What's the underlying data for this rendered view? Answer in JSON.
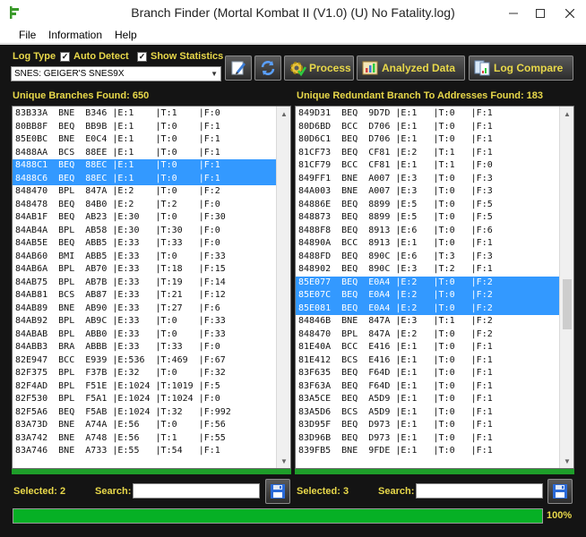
{
  "window": {
    "title": "Branch Finder (Mortal Kombat II (V1.0) (U) No Fatality.log)"
  },
  "menu": [
    "File",
    "Information",
    "Help"
  ],
  "options": {
    "log_type_label": "Log Type",
    "auto_detect_label": "Auto Detect",
    "auto_detect_checked": true,
    "show_statistics_label": "Show Statistics",
    "show_statistics_checked": true,
    "log_type_value": "SNES: GEIGER'S SNES9X"
  },
  "toolbar": {
    "edit_icon": "edit-icon",
    "refresh_icon": "refresh-icon",
    "process_label": "Process",
    "analyzed_label": "Analyzed Data",
    "compare_label": "Log Compare"
  },
  "left_panel": {
    "title": "Unique Branches Found: 650",
    "rows": [
      {
        "text": "83B33A  BNE  B346 |E:1    |T:1    |F:0",
        "selected": false
      },
      {
        "text": "80BB8F  BEQ  BB9B |E:1    |T:0    |F:1",
        "selected": false
      },
      {
        "text": "85E0BC  BNE  E0C4 |E:1    |T:0    |F:1",
        "selected": false
      },
      {
        "text": "8488AA  BCS  88EE |E:1    |T:0    |F:1",
        "selected": false
      },
      {
        "text": "8488C1  BEQ  88EC |E:1    |T:0    |F:1",
        "selected": true
      },
      {
        "text": "8488C6  BEQ  88EC |E:1    |T:0    |F:1",
        "selected": true
      },
      {
        "text": "848470  BPL  847A |E:2    |T:0    |F:2",
        "selected": false
      },
      {
        "text": "848478  BEQ  84B0 |E:2    |T:2    |F:0",
        "selected": false
      },
      {
        "text": "84AB1F  BEQ  AB23 |E:30   |T:0    |F:30",
        "selected": false
      },
      {
        "text": "84AB4A  BPL  AB58 |E:30   |T:30   |F:0",
        "selected": false
      },
      {
        "text": "84AB5E  BEQ  ABB5 |E:33   |T:33   |F:0",
        "selected": false
      },
      {
        "text": "84AB60  BMI  ABB5 |E:33   |T:0    |F:33",
        "selected": false
      },
      {
        "text": "84AB6A  BPL  AB70 |E:33   |T:18   |F:15",
        "selected": false
      },
      {
        "text": "84AB75  BPL  AB7B |E:33   |T:19   |F:14",
        "selected": false
      },
      {
        "text": "84AB81  BCS  AB87 |E:33   |T:21   |F:12",
        "selected": false
      },
      {
        "text": "84AB89  BNE  AB90 |E:33   |T:27   |F:6",
        "selected": false
      },
      {
        "text": "84AB92  BPL  AB9C |E:33   |T:0    |F:33",
        "selected": false
      },
      {
        "text": "84ABAB  BPL  ABB0 |E:33   |T:0    |F:33",
        "selected": false
      },
      {
        "text": "84ABB3  BRA  ABBB |E:33   |T:33   |F:0",
        "selected": false
      },
      {
        "text": "82E947  BCC  E939 |E:536  |T:469  |F:67",
        "selected": false
      },
      {
        "text": "82F375  BPL  F37B |E:32   |T:0    |F:32",
        "selected": false
      },
      {
        "text": "82F4AD  BPL  F51E |E:1024 |T:1019 |F:5",
        "selected": false
      },
      {
        "text": "82F530  BPL  F5A1 |E:1024 |T:1024 |F:0",
        "selected": false
      },
      {
        "text": "82F5A6  BEQ  F5AB |E:1024 |T:32   |F:992",
        "selected": false
      },
      {
        "text": "83A73D  BNE  A74A |E:56   |T:0    |F:56",
        "selected": false
      },
      {
        "text": "83A742  BNE  A748 |E:56   |T:1    |F:55",
        "selected": false
      },
      {
        "text": "83A746  BNE  A733 |E:55   |T:54   |F:1",
        "selected": false
      }
    ],
    "selected_label": "Selected: 2",
    "search_label": "Search:",
    "search_value": ""
  },
  "right_panel": {
    "title": "Unique Redundant Branch To Addresses Found: 183",
    "rows": [
      {
        "text": "849D31  BEQ  9D7D |E:1   |T:0   |F:1",
        "selected": false
      },
      {
        "text": "80D6BD  BCC  D706 |E:1   |T:0   |F:1",
        "selected": false
      },
      {
        "text": "80D6C1  BEQ  D706 |E:1   |T:0   |F:1",
        "selected": false
      },
      {
        "text": "81CF73  BEQ  CF81 |E:2   |T:1   |F:1",
        "selected": false
      },
      {
        "text": "81CF79  BCC  CF81 |E:1   |T:1   |F:0",
        "selected": false
      },
      {
        "text": "849FF1  BNE  A007 |E:3   |T:0   |F:3",
        "selected": false
      },
      {
        "text": "84A003  BNE  A007 |E:3   |T:0   |F:3",
        "selected": false
      },
      {
        "text": "84886E  BEQ  8899 |E:5   |T:0   |F:5",
        "selected": false
      },
      {
        "text": "848873  BEQ  8899 |E:5   |T:0   |F:5",
        "selected": false
      },
      {
        "text": "8488F8  BEQ  8913 |E:6   |T:0   |F:6",
        "selected": false
      },
      {
        "text": "84890A  BCC  8913 |E:1   |T:0   |F:1",
        "selected": false
      },
      {
        "text": "8488FD  BEQ  890C |E:6   |T:3   |F:3",
        "selected": false
      },
      {
        "text": "848902  BEQ  890C |E:3   |T:2   |F:1",
        "selected": false
      },
      {
        "text": "85E077  BEQ  E0A4 |E:2   |T:0   |F:2",
        "selected": true
      },
      {
        "text": "85E07C  BEQ  E0A4 |E:2   |T:0   |F:2",
        "selected": true
      },
      {
        "text": "85E081  BEQ  E0A4 |E:2   |T:0   |F:2",
        "selected": true
      },
      {
        "text": "84846B  BNE  847A |E:3   |T:1   |F:2",
        "selected": false
      },
      {
        "text": "848470  BPL  847A |E:2   |T:0   |F:2",
        "selected": false
      },
      {
        "text": "81E40A  BCC  E416 |E:1   |T:0   |F:1",
        "selected": false
      },
      {
        "text": "81E412  BCS  E416 |E:1   |T:0   |F:1",
        "selected": false
      },
      {
        "text": "83F635  BEQ  F64D |E:1   |T:0   |F:1",
        "selected": false
      },
      {
        "text": "83F63A  BEQ  F64D |E:1   |T:0   |F:1",
        "selected": false
      },
      {
        "text": "83A5CE  BEQ  A5D9 |E:1   |T:0   |F:1",
        "selected": false
      },
      {
        "text": "83A5D6  BCS  A5D9 |E:1   |T:0   |F:1",
        "selected": false
      },
      {
        "text": "83D95F  BEQ  D973 |E:1   |T:0   |F:1",
        "selected": false
      },
      {
        "text": "83D96B  BEQ  D973 |E:1   |T:0   |F:1",
        "selected": false
      },
      {
        "text": "839FB5  BNE  9FDE |E:1   |T:0   |F:1",
        "selected": false
      }
    ],
    "selected_label": "Selected: 3",
    "search_label": "Search:",
    "search_value": ""
  },
  "progress": {
    "value": 1.0,
    "label": "100%"
  },
  "colors": {
    "accent_text": "#e8d84a",
    "selection": "#3399ff",
    "progress": "#06b025",
    "background": "#141414"
  }
}
